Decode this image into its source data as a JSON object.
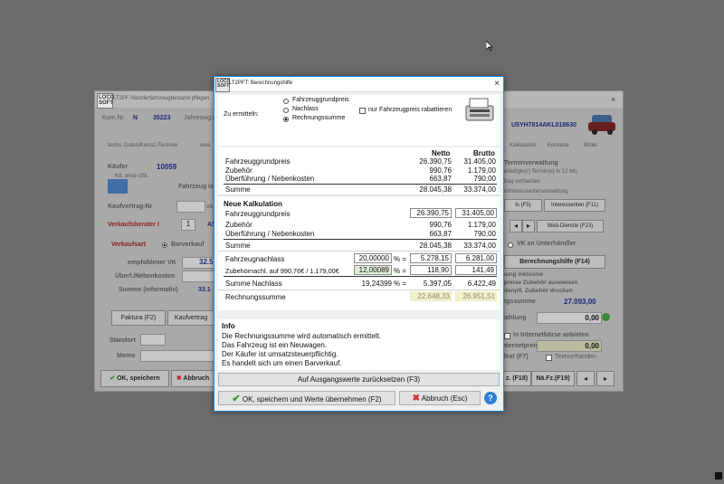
{
  "bg_window": {
    "title": "LT2PF Händlerfahrzeugbestand pflegen",
    "logo": "LOCO SOFT",
    "kom_nr_label": "Kom.Nr.",
    "kom_nr_value": "N",
    "kom_nr_number": "35223",
    "jahreswg_label": "Jahreswg.K",
    "vin": "U5YH7814AKL018630",
    "tabs": [
      "techn. Daten/Kennz./Termine",
      "wea",
      "Kalkulation",
      "Kontakte",
      "Bilder"
    ],
    "kaeufer_label": "Käufer",
    "kaeufer_value": "10059",
    "kd_ohne_ust": "Kd. ohne USt.",
    "fahrzeug_ist": "Fahrzeug ist",
    "kaufvertrag_label": "Kaufvertrag-Nr",
    "kaufvertrag_suffix": "vo",
    "verkaufsberater_label": "Verkaufsberater I",
    "verkaufsberater_value": "1",
    "verkaufsberater_suffix": "AS",
    "verkaufsart_label": "Verkaufsart",
    "barverkauf": "Barverkauf",
    "empf_vk_label": "empfohlener VK",
    "empf_vk_value": "32.5",
    "ueberf_label": "Überf./Nebenkosten",
    "summe_inf_label": "Summe (informativ)",
    "summe_inf_value": "33.1",
    "faktura_btn": "Faktura (F2)",
    "kaufvertrag_btn": "Kaufvertrag",
    "standort_label": "Standort",
    "memo_label": "Memo",
    "ok_btn": "OK, speichern",
    "abbruch_btn": "Abbruch",
    "termin": "Terminverwaltung",
    "termin_lines": [
      "erledigte(r) Termin(e) in 12 Mo.",
      "trag vorhanden",
      "n/Interessentenverwaltung"
    ],
    "sts_btn": "ts (F5)",
    "interessenten_btn": "Interessenten (F11)",
    "webdienste_btn": "Web-Dienste (F23)",
    "vk_haendler": "VK an Unterhändler",
    "berechnungshilfe_btn": "Berechnungshilfe (F14)",
    "inkl_lines": [
      "sung inklusive",
      "lpreise Zubehör ausweisen",
      "stenpfl. Zubehör drucken"
    ],
    "ngssumme_label": "ngssumme",
    "ngssumme_value": "27.093,00",
    "zahlung_label": "zahlung",
    "zahlung_value": "0,00",
    "internetboerse": "In Internetbörse anbieten",
    "internetpreis_label": "nternetpreis",
    "internetpreis_value": "0,00",
    "text_label": "Text (F7)",
    "textvorhanden": "Textvorhanden",
    "btn_f18": "z. (F18)",
    "btn_f19": "Nä.Fz.(F19)"
  },
  "dialog": {
    "logo": "LOCO SOFT",
    "title": "LT2PFT: Berechnungshilfe",
    "close": "×",
    "zu_ermitteln": "Zu ermitteln:",
    "radio_options": [
      "Fahrzeuggrundpreis",
      "Nachlass",
      "Rechnungssumme"
    ],
    "nur_fzg_checkbox": "nur Fahrzeugpreis rabattieren",
    "col_netto": "Netto",
    "col_brutto": "Brutto",
    "orig_rows": [
      {
        "label": "Fahrzeuggrundpreis",
        "netto": "26.390,75",
        "brutto": "31.405,00"
      },
      {
        "label": "Zubehör",
        "netto": "990,76",
        "brutto": "1.179,00"
      },
      {
        "label": "Überführung / Nebenkosten",
        "netto": "663,87",
        "brutto": "790,00"
      },
      {
        "label": "Summe",
        "netto": "28.045,38",
        "brutto": "33.374,00"
      }
    ],
    "neue_kalkulation": "Neue Kalkulation",
    "new_rows": [
      {
        "label": "Fahrzeuggrundpreis",
        "netto": "26.390,75",
        "brutto": "31.405,00"
      },
      {
        "label": "Zubehör",
        "netto": "990,76",
        "brutto": "1.179,00"
      },
      {
        "label": "Überführung / Nebenkosten",
        "netto": "663,87",
        "brutto": "790,00"
      },
      {
        "label": "Summe",
        "netto": "28.045,38",
        "brutto": "33.374,00"
      }
    ],
    "nachlass_rows": [
      {
        "label": "Fahrzeugnachlass",
        "pct": "20,00000",
        "sym": "% =",
        "netto": "5.278,15",
        "brutto": "6.281,00"
      },
      {
        "label": "Zubehörnachl. auf 990,76€ / 1.179,00€",
        "pct": "12,00089",
        "sym": "% =",
        "netto": "118,90",
        "brutto": "141,49"
      },
      {
        "label": "Summe Nachlass",
        "pct": "19,24399",
        "sym": "% =",
        "netto": "5.397,05",
        "brutto": "6.422,49"
      }
    ],
    "rechnungssumme_label": "Rechnungssumme",
    "rechnungssumme_netto": "22.648,33",
    "rechnungssumme_brutto": "26.951,51",
    "info_title": "Info",
    "info_lines": [
      "Die Rechnungssumme wird automatisch ermittelt.",
      "Das Fahrzeug ist ein Neuwagen.",
      "Der Käufer ist umsatzsteuerpflichtig.",
      "Es handelt sich um einen Barverkauf."
    ],
    "reset_btn": "Auf Ausgangswerte zurücksetzen (F3)",
    "ok_btn": "OK, speichern und Werte übernehmen (F2)",
    "abbruch_btn": "Abbruch (Esc)",
    "help_btn": "?"
  },
  "colors": {
    "accent": "#1e88e5",
    "ok_green": "#2e9e2e",
    "cancel_red": "#d32f2f",
    "rechnungssumme_bg": "#f2efc9"
  }
}
